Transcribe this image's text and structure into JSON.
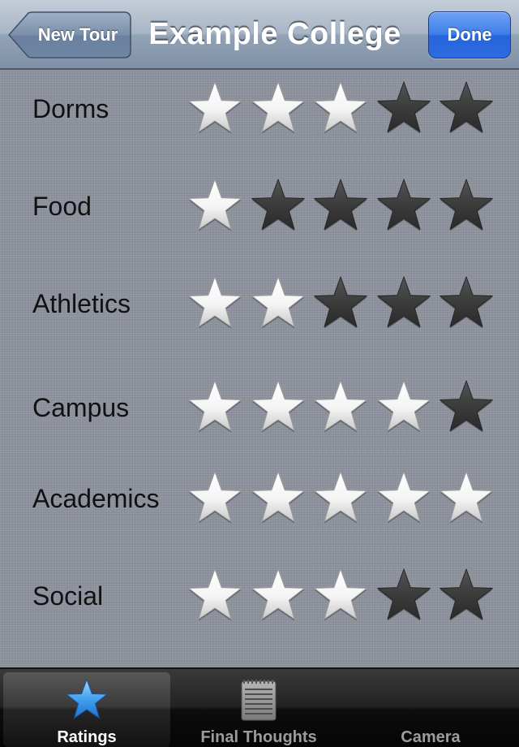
{
  "nav": {
    "back_label": "New Tour",
    "title": "Example College",
    "done_label": "Done"
  },
  "ratings": [
    {
      "label": "Dorms",
      "stars": 3,
      "max": 5
    },
    {
      "label": "Food",
      "stars": 1,
      "max": 5
    },
    {
      "label": "Athletics",
      "stars": 2,
      "max": 5
    },
    {
      "label": "Campus",
      "stars": 4,
      "max": 5
    },
    {
      "label": "Academics",
      "stars": 5,
      "max": 5
    },
    {
      "label": "Social",
      "stars": 3,
      "max": 5
    }
  ],
  "tabs": [
    {
      "label": "Ratings",
      "icon": "star-icon",
      "selected": true
    },
    {
      "label": "Final Thoughts",
      "icon": "notepad-icon",
      "selected": false
    },
    {
      "label": "Camera",
      "icon": "camera-icon",
      "selected": false
    }
  ],
  "colors": {
    "star_filled": "#f4f4f4",
    "star_empty": "#3c3c3c",
    "tab_selected_icon": "#4aa3f0",
    "done_button": "#3f7fe9"
  }
}
